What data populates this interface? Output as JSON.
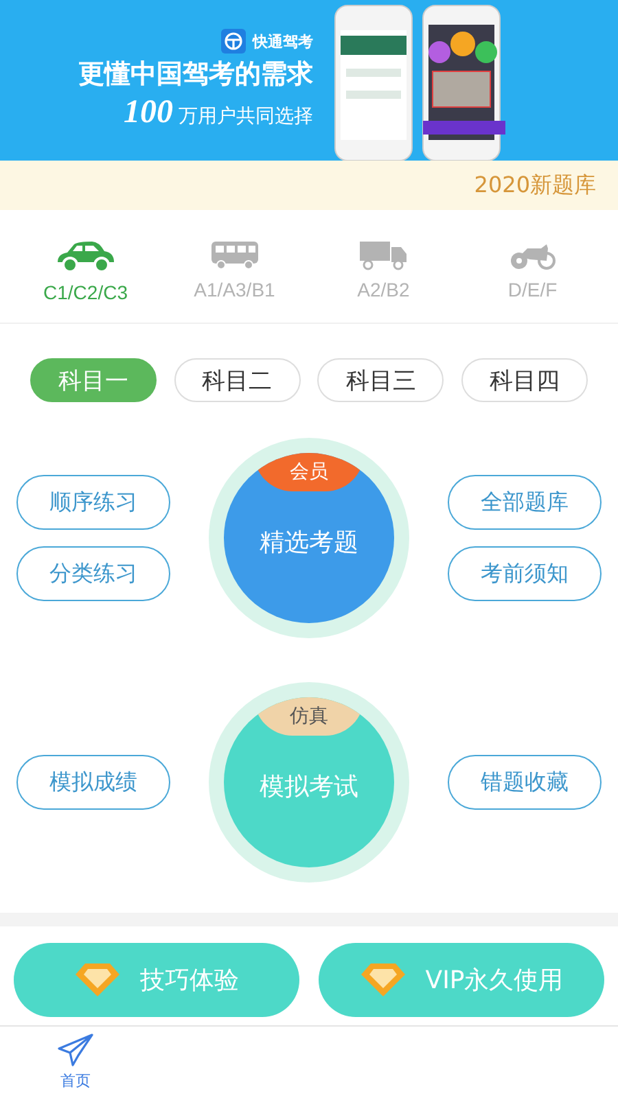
{
  "banner": {
    "app_name": "快通驾考",
    "headline": "更懂中国驾考的需求",
    "user_count": "100",
    "user_tagline": "万用户共同选择"
  },
  "notice": "2020新题库",
  "license_types": [
    {
      "label": "C1/C2/C3",
      "kind": "car",
      "selected": true
    },
    {
      "label": "A1/A3/B1",
      "kind": "bus",
      "selected": false
    },
    {
      "label": "A2/B2",
      "kind": "truck",
      "selected": false
    },
    {
      "label": "D/E/F",
      "kind": "motorcycle",
      "selected": false
    }
  ],
  "subjects": [
    {
      "label": "科目一",
      "selected": true
    },
    {
      "label": "科目二",
      "selected": false
    },
    {
      "label": "科目三",
      "selected": false
    },
    {
      "label": "科目四",
      "selected": false
    }
  ],
  "sections": [
    {
      "kind": "member",
      "badge": "会员",
      "label": "精选考题",
      "left": [
        "顺序练习",
        "分类练习"
      ],
      "right": [
        "全部题库",
        "考前须知"
      ]
    },
    {
      "kind": "exam",
      "badge": "仿真",
      "label": "模拟考试",
      "left": [
        "模拟成绩"
      ],
      "right": [
        "错题收藏"
      ]
    }
  ],
  "bottom_buttons": [
    "技巧体验",
    "VIP永久使用"
  ],
  "tab_bar": [
    {
      "label": "首页",
      "selected": true
    }
  ]
}
